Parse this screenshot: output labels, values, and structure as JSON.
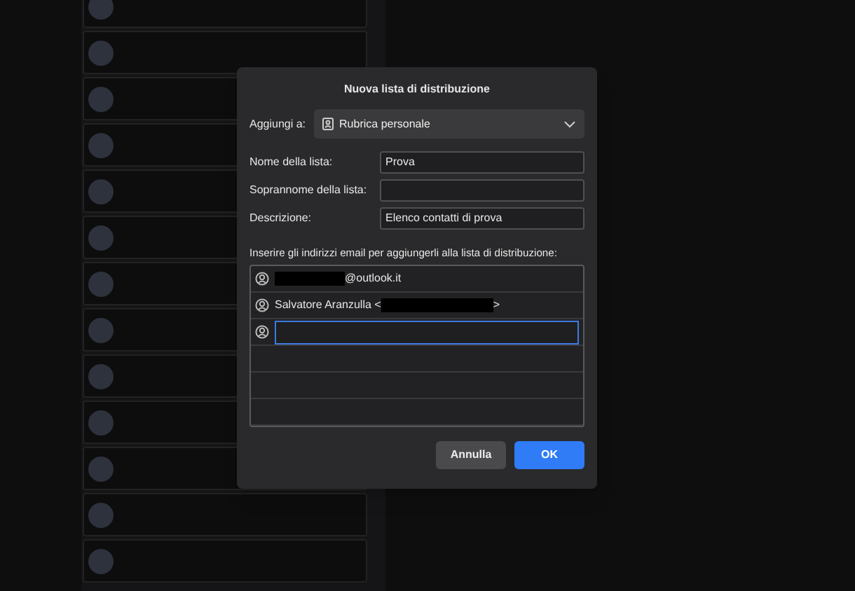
{
  "dialog": {
    "title": "Nuova lista di distribuzione",
    "add_to": {
      "label": "Aggiungi a:",
      "value": "Rubrica personale"
    },
    "fields": [
      {
        "label": "Nome della lista:",
        "value": "Prova"
      },
      {
        "label": "Soprannome della lista:"
      },
      {
        "label": "Descrizione:",
        "value": "Elenco contatti di prova"
      }
    ],
    "instructions": "Inserire gli indirizzi email per aggiungerli alla lista di distribuzione:",
    "addresses": [
      {
        "focused": false,
        "parts": [
          {
            "kind": "redacted"
          },
          {
            "kind": "text",
            "text": "@outlook.it"
          }
        ]
      },
      {
        "focused": false,
        "parts": [
          {
            "kind": "text",
            "text": "Salvatore Aranzulla <"
          },
          {
            "kind": "redacted"
          },
          {
            "kind": "text",
            "text": ">"
          }
        ]
      },
      {
        "focused": true
      }
    ],
    "buttons": [
      {
        "label": "Annulla",
        "kind": "secondary"
      },
      {
        "label": "OK",
        "kind": "primary"
      }
    ]
  }
}
